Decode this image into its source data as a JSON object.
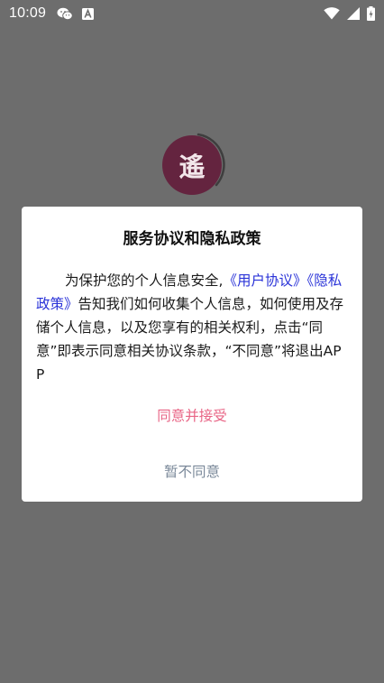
{
  "status_bar": {
    "time": "10:09",
    "notification_icons": [
      "wechat-icon",
      "a-letter-icon"
    ],
    "system_icons": [
      "wifi-icon",
      "signal-icon",
      "battery-icon"
    ]
  },
  "splash": {
    "logo_char": "遙",
    "logo_color": "#64243f"
  },
  "dialog": {
    "title": "服务协议和隐私政策",
    "body": {
      "intro": "为保护您的个人信息安全,",
      "user_agreement_link": "《用户协议》",
      "privacy_policy_link": "《隐私政策》",
      "rest": "告知我们如何收集个人信息，如何使用及存储个人信息，以及您享有的相关权利，点击“同意”即表示同意相关协议条款，“不同意”将退出APP"
    },
    "agree_label": "同意并接受",
    "disagree_label": "暂不同意"
  },
  "colors": {
    "overlay": "#6d6d6d",
    "link": "#2a33d8",
    "agree": "#e86485",
    "disagree": "#7a8899"
  }
}
